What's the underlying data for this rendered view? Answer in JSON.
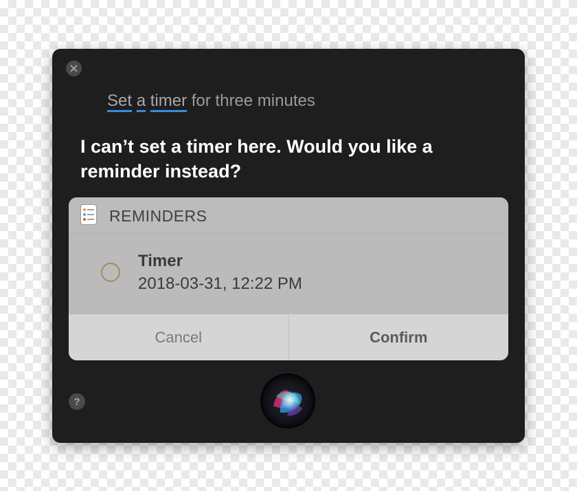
{
  "window": {
    "close_icon": "close-icon",
    "help_label": "?",
    "help_icon": "question-mark-icon"
  },
  "query": {
    "word1": "Set",
    "word2": "a",
    "word3": "timer",
    "rest": " for three minutes"
  },
  "response": {
    "text": "I can’t set a timer here. Would you like a reminder instead?"
  },
  "card": {
    "app_name": "REMINDERS",
    "app_icon": "reminders-list-icon",
    "reminder": {
      "title": "Timer",
      "datetime": "2018-03-31, 12:22 PM"
    },
    "cancel_label": "Cancel",
    "confirm_label": "Confirm"
  },
  "siri": {
    "icon": "siri-orb-icon"
  },
  "colors": {
    "window_bg": "#1e1e1f",
    "underline_accent": "#2f8fe0",
    "card_bg": "#bdbdbd",
    "actions_bg": "#d5d5d5",
    "checkbox_ring": "#a68a5c"
  }
}
